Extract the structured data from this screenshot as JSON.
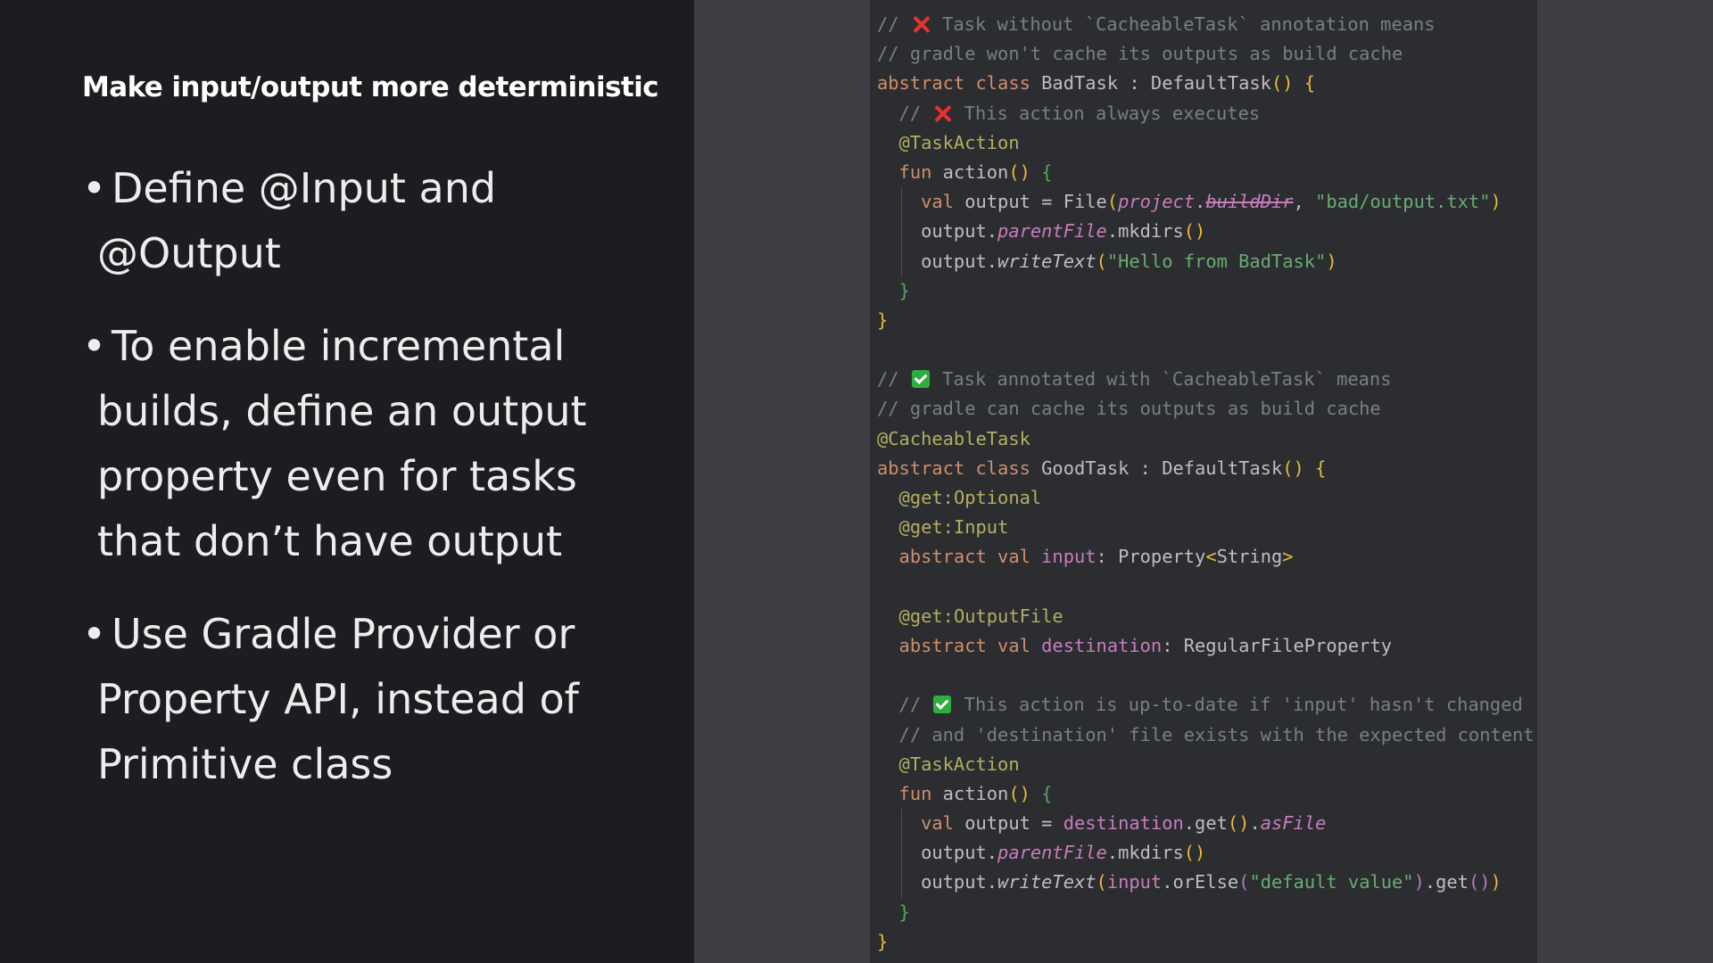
{
  "slide": {
    "title": "Make input/output more deterministic",
    "bullets": [
      {
        "lines": [
          "Define @Input and",
          "@Output"
        ]
      },
      {
        "lines": [
          "To enable incremental",
          "builds, define an output",
          "property even for tasks",
          "that don’t have output"
        ]
      },
      {
        "lines": [
          "Use Gradle Provider or",
          "Property API, instead of",
          "Primitive class"
        ]
      }
    ],
    "bullet_char": "•"
  },
  "colors": {
    "comment": "#7a7e85",
    "keyword": "#cf8e6d",
    "annotation": "#b3ae60",
    "property": "#c77dbb",
    "string": "#6aab73",
    "text": "#bcbec4",
    "function": "#56a8f5",
    "bracket_yellow": "#e8ba36",
    "bracket_green": "#54a857",
    "bracket_purple": "#b47ab8"
  },
  "code": [
    {
      "guides": [],
      "tokens": [
        {
          "t": "// ",
          "c": "comment"
        },
        {
          "emoji": "cross"
        },
        {
          "t": " Task without `CacheableTask` annotation means",
          "c": "comment"
        }
      ]
    },
    {
      "guides": [],
      "tokens": [
        {
          "t": "// gradle won't cache its outputs as build cache",
          "c": "comment"
        }
      ]
    },
    {
      "guides": [],
      "tokens": [
        {
          "t": "abstract class ",
          "c": "keyword"
        },
        {
          "t": "BadTask : DefaultTask",
          "c": "text"
        },
        {
          "t": "()",
          "c": "bracket_yellow"
        },
        {
          "t": " ",
          "c": "text"
        },
        {
          "t": "{",
          "c": "bracket_yellow"
        }
      ]
    },
    {
      "guides": [],
      "tokens": [
        {
          "t": "  // ",
          "c": "comment"
        },
        {
          "emoji": "cross"
        },
        {
          "t": " This action always executes",
          "c": "comment"
        }
      ]
    },
    {
      "guides": [],
      "tokens": [
        {
          "t": "  @TaskAction",
          "c": "annotation"
        }
      ]
    },
    {
      "guides": [],
      "tokens": [
        {
          "t": "  fun ",
          "c": "keyword"
        },
        {
          "t": "action",
          "c": "text"
        },
        {
          "t": "()",
          "c": "bracket_yellow"
        },
        {
          "t": " ",
          "c": "text"
        },
        {
          "t": "{",
          "c": "bracket_green"
        }
      ]
    },
    {
      "guides": [
        2
      ],
      "tokens": [
        {
          "t": "    val ",
          "c": "keyword"
        },
        {
          "t": "output = File",
          "c": "text"
        },
        {
          "t": "(",
          "c": "bracket_yellow"
        },
        {
          "t": "project",
          "c": "property",
          "i": true
        },
        {
          "t": ".",
          "c": "text"
        },
        {
          "t": "buildDir",
          "c": "property",
          "i": true,
          "s": true
        },
        {
          "t": ", ",
          "c": "text"
        },
        {
          "t": "\"bad/output.txt\"",
          "c": "string"
        },
        {
          "t": ")",
          "c": "bracket_yellow"
        }
      ]
    },
    {
      "guides": [
        2
      ],
      "tokens": [
        {
          "t": "    output.",
          "c": "text"
        },
        {
          "t": "parentFile",
          "c": "property",
          "i": true
        },
        {
          "t": ".mkdirs",
          "c": "text"
        },
        {
          "t": "()",
          "c": "bracket_yellow"
        }
      ]
    },
    {
      "guides": [
        2
      ],
      "tokens": [
        {
          "t": "    output.",
          "c": "text"
        },
        {
          "t": "writeText",
          "c": "text",
          "i": true
        },
        {
          "t": "(",
          "c": "bracket_yellow"
        },
        {
          "t": "\"Hello from BadTask\"",
          "c": "string"
        },
        {
          "t": ")",
          "c": "bracket_yellow"
        }
      ]
    },
    {
      "guides": [],
      "tokens": [
        {
          "t": "  }",
          "c": "bracket_green"
        }
      ]
    },
    {
      "guides": [],
      "tokens": [
        {
          "t": "}",
          "c": "bracket_yellow"
        }
      ]
    },
    {
      "guides": [],
      "tokens": []
    },
    {
      "guides": [],
      "tokens": [
        {
          "t": "// ",
          "c": "comment"
        },
        {
          "emoji": "check"
        },
        {
          "t": " Task annotated with `CacheableTask` means",
          "c": "comment"
        }
      ]
    },
    {
      "guides": [],
      "tokens": [
        {
          "t": "// gradle can cache its outputs as build cache",
          "c": "comment"
        }
      ]
    },
    {
      "guides": [],
      "tokens": [
        {
          "t": "@CacheableTask",
          "c": "annotation"
        }
      ]
    },
    {
      "guides": [],
      "tokens": [
        {
          "t": "abstract class ",
          "c": "keyword"
        },
        {
          "t": "GoodTask : DefaultTask",
          "c": "text"
        },
        {
          "t": "()",
          "c": "bracket_yellow"
        },
        {
          "t": " ",
          "c": "text"
        },
        {
          "t": "{",
          "c": "bracket_yellow"
        }
      ]
    },
    {
      "guides": [],
      "tokens": [
        {
          "t": "  @get",
          "c": "annotation"
        },
        {
          "t": ":Optional",
          "c": "annotation"
        }
      ]
    },
    {
      "guides": [],
      "tokens": [
        {
          "t": "  @get",
          "c": "annotation"
        },
        {
          "t": ":Input",
          "c": "annotation"
        }
      ]
    },
    {
      "guides": [],
      "tokens": [
        {
          "t": "  abstract val ",
          "c": "keyword"
        },
        {
          "t": "input",
          "c": "property"
        },
        {
          "t": ": Property",
          "c": "text"
        },
        {
          "t": "<",
          "c": "bracket_yellow"
        },
        {
          "t": "String",
          "c": "text"
        },
        {
          "t": ">",
          "c": "bracket_yellow"
        }
      ]
    },
    {
      "guides": [],
      "tokens": []
    },
    {
      "guides": [],
      "tokens": [
        {
          "t": "  @get",
          "c": "annotation"
        },
        {
          "t": ":OutputFile",
          "c": "annotation"
        }
      ]
    },
    {
      "guides": [],
      "tokens": [
        {
          "t": "  abstract val ",
          "c": "keyword"
        },
        {
          "t": "destination",
          "c": "property"
        },
        {
          "t": ": RegularFileProperty",
          "c": "text"
        }
      ]
    },
    {
      "guides": [],
      "tokens": []
    },
    {
      "guides": [],
      "tokens": [
        {
          "t": "  // ",
          "c": "comment"
        },
        {
          "emoji": "check"
        },
        {
          "t": " This action is up-to-date if 'input' hasn't changed",
          "c": "comment"
        }
      ]
    },
    {
      "guides": [],
      "tokens": [
        {
          "t": "  // and 'destination' file exists with the expected content",
          "c": "comment"
        }
      ]
    },
    {
      "guides": [],
      "tokens": [
        {
          "t": "  @TaskAction",
          "c": "annotation"
        }
      ]
    },
    {
      "guides": [],
      "tokens": [
        {
          "t": "  fun ",
          "c": "keyword"
        },
        {
          "t": "action",
          "c": "text"
        },
        {
          "t": "()",
          "c": "bracket_yellow"
        },
        {
          "t": " ",
          "c": "text"
        },
        {
          "t": "{",
          "c": "bracket_green"
        }
      ]
    },
    {
      "guides": [
        2
      ],
      "tokens": [
        {
          "t": "    val ",
          "c": "keyword"
        },
        {
          "t": "output = ",
          "c": "text"
        },
        {
          "t": "destination",
          "c": "property"
        },
        {
          "t": ".get",
          "c": "text"
        },
        {
          "t": "()",
          "c": "bracket_yellow"
        },
        {
          "t": ".",
          "c": "text"
        },
        {
          "t": "asFile",
          "c": "property",
          "i": true
        }
      ]
    },
    {
      "guides": [
        2
      ],
      "tokens": [
        {
          "t": "    output.",
          "c": "text"
        },
        {
          "t": "parentFile",
          "c": "property",
          "i": true
        },
        {
          "t": ".mkdirs",
          "c": "text"
        },
        {
          "t": "()",
          "c": "bracket_yellow"
        }
      ]
    },
    {
      "guides": [
        2
      ],
      "tokens": [
        {
          "t": "    output.",
          "c": "text"
        },
        {
          "t": "writeText",
          "c": "text",
          "i": true
        },
        {
          "t": "(",
          "c": "bracket_yellow"
        },
        {
          "t": "input",
          "c": "property"
        },
        {
          "t": ".orElse",
          "c": "text"
        },
        {
          "t": "(",
          "c": "bracket_purple"
        },
        {
          "t": "\"default value\"",
          "c": "string"
        },
        {
          "t": ")",
          "c": "bracket_purple"
        },
        {
          "t": ".get",
          "c": "text"
        },
        {
          "t": "()",
          "c": "bracket_purple"
        },
        {
          "t": ")",
          "c": "bracket_yellow"
        }
      ]
    },
    {
      "guides": [],
      "tokens": [
        {
          "t": "  }",
          "c": "bracket_green"
        }
      ]
    },
    {
      "guides": [],
      "tokens": [
        {
          "t": "}",
          "c": "bracket_yellow"
        }
      ]
    }
  ]
}
